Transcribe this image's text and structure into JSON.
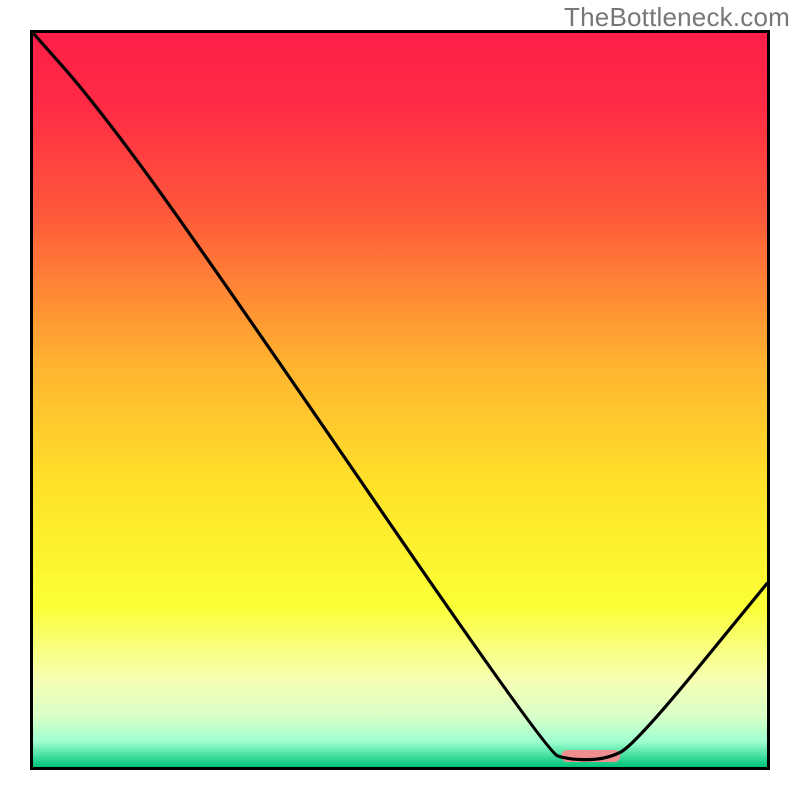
{
  "watermark": "TheBottleneck.com",
  "chart_data": {
    "type": "line",
    "title": "",
    "xlabel": "",
    "ylabel": "",
    "xlim": [
      0,
      100
    ],
    "ylim": [
      0,
      100
    ],
    "grid": false,
    "legend": false,
    "annotations": [],
    "series": [
      {
        "name": "curve",
        "x": [
          0,
          8,
          22,
          70,
          73,
          78,
          82,
          100
        ],
        "y": [
          100,
          91,
          72,
          2,
          1,
          1,
          3,
          25
        ]
      }
    ],
    "marker": {
      "name": "highlight-pill",
      "x_center": 76,
      "y": 1.5,
      "width": 8,
      "color": "#ef8f8f"
    },
    "background_gradient": {
      "stops": [
        {
          "offset": 0.0,
          "color": "#ff1f48"
        },
        {
          "offset": 0.1,
          "color": "#ff2b45"
        },
        {
          "offset": 0.25,
          "color": "#ff5a3a"
        },
        {
          "offset": 0.45,
          "color": "#ffb330"
        },
        {
          "offset": 0.62,
          "color": "#ffe329"
        },
        {
          "offset": 0.78,
          "color": "#fbff35"
        },
        {
          "offset": 0.88,
          "color": "#f7ffb2"
        },
        {
          "offset": 0.93,
          "color": "#d9ffc8"
        },
        {
          "offset": 0.965,
          "color": "#9fffd0"
        },
        {
          "offset": 1.0,
          "color": "#00c47a"
        }
      ]
    }
  }
}
